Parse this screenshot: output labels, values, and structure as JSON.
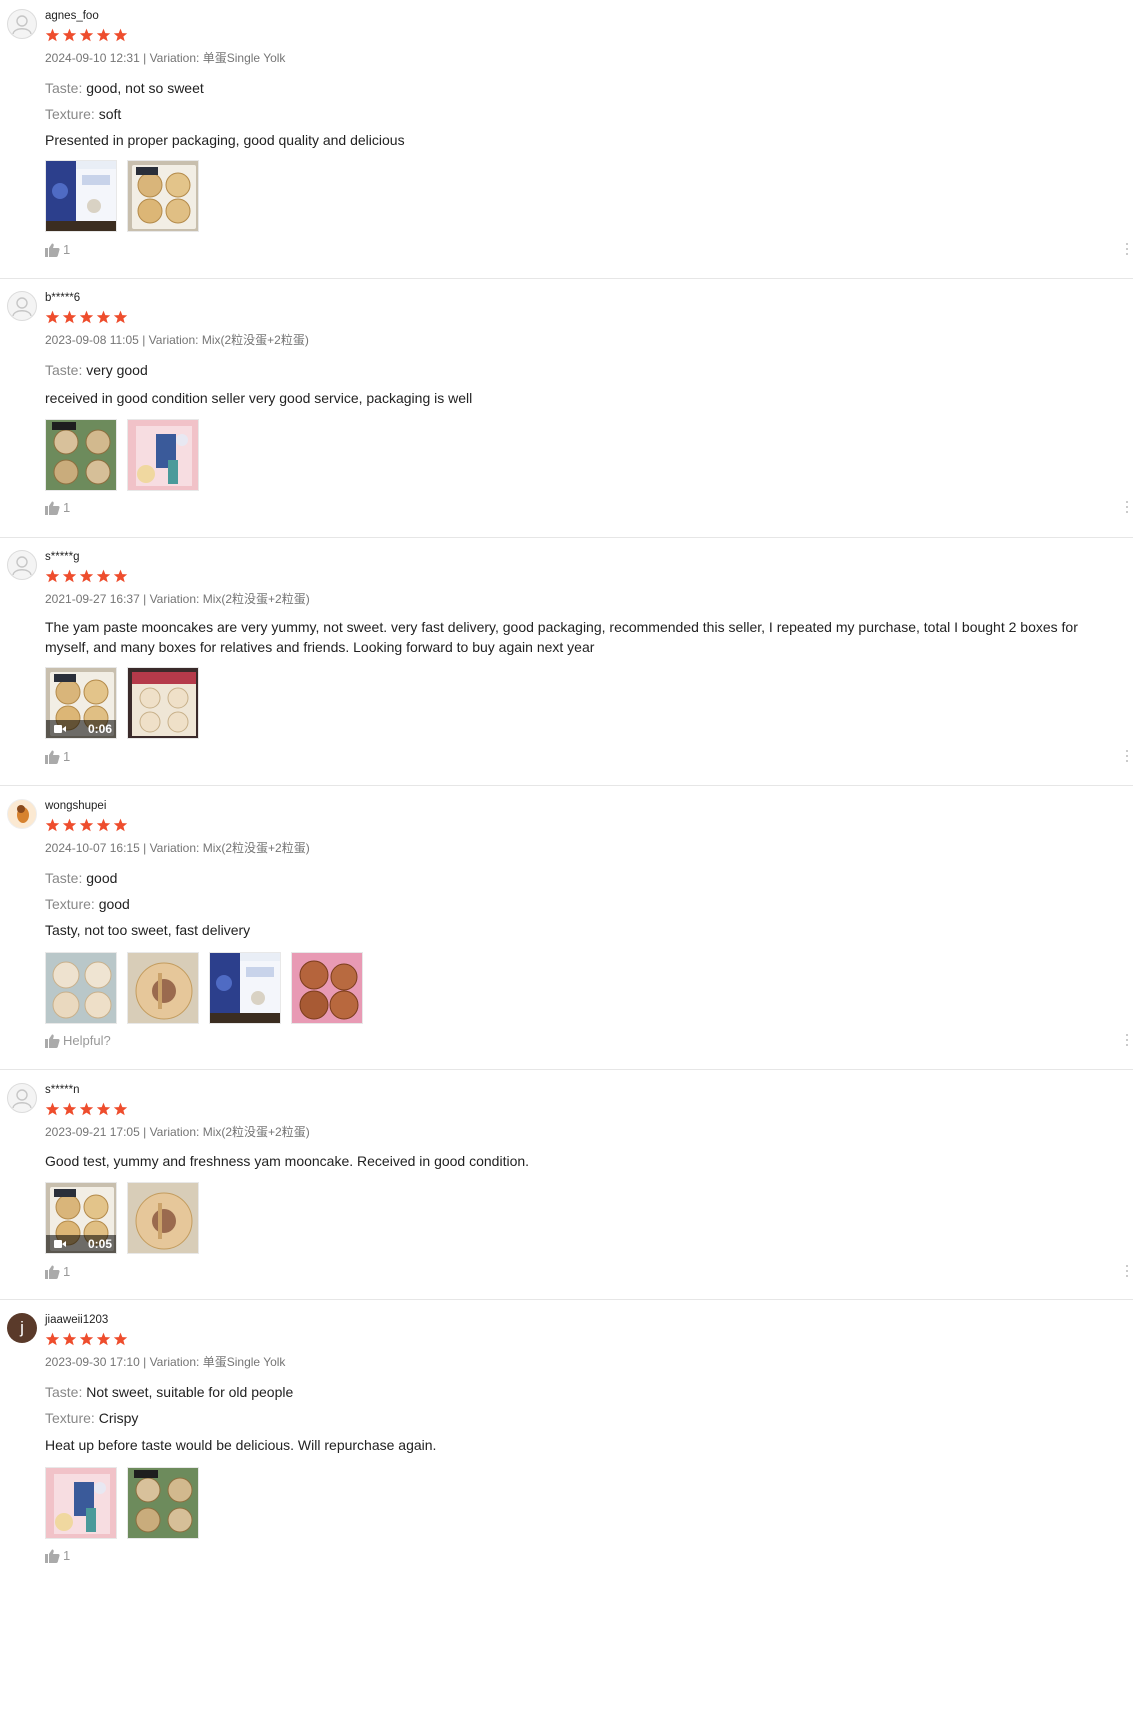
{
  "reviews": [
    {
      "username": "agnes_foo",
      "avatar": "default-avatar-icon",
      "rating": 5,
      "date": "2024-09-10 12:31",
      "variation": "单蛋Single Yolk",
      "attributes": [
        {
          "key": "Taste:",
          "value": "good, not so sweet"
        },
        {
          "key": "Texture:",
          "value": "soft"
        }
      ],
      "comment": "Presented in proper packaging, good quality and delicious",
      "media": [
        {
          "kind": "photo",
          "theme": "blue-box"
        },
        {
          "kind": "photo",
          "theme": "box-cakes"
        }
      ],
      "likes": "1"
    },
    {
      "username": "b*****6",
      "avatar": "default-avatar-icon",
      "rating": 5,
      "date": "2023-09-08 11:05",
      "variation": "Mix(2粒没蛋+2粒蛋)",
      "attributes": [
        {
          "key": "Taste:",
          "value": "very good"
        }
      ],
      "comment": "received in good condition seller very good service, packaging is well",
      "media": [
        {
          "kind": "photo",
          "theme": "green-cakes"
        },
        {
          "kind": "photo",
          "theme": "pink-box"
        }
      ],
      "likes": "1"
    },
    {
      "username": "s*****g",
      "avatar": "default-avatar-icon",
      "rating": 5,
      "date": "2021-09-27 16:37",
      "variation": "Mix(2粒没蛋+2粒蛋)",
      "attributes": [],
      "comment": "The yam paste mooncakes are very yummy, not sweet. very fast delivery, good packaging, recommended this seller, I repeated my purchase, total I bought 2 boxes for myself, and many boxes for relatives and friends. Looking forward to buy again next year",
      "media": [
        {
          "kind": "video",
          "theme": "box-cakes",
          "duration": "0:06"
        },
        {
          "kind": "photo",
          "theme": "red-box"
        }
      ],
      "likes": "1"
    },
    {
      "username": "wongshupei",
      "avatar": "photo-avatar-icon",
      "rating": 5,
      "date": "2024-10-07 16:15",
      "variation": "Mix(2粒没蛋+2粒蛋)",
      "attributes": [
        {
          "key": "Taste:",
          "value": "good"
        },
        {
          "key": "Texture:",
          "value": "good"
        }
      ],
      "comment": "Tasty, not too sweet, fast delivery",
      "media": [
        {
          "kind": "photo",
          "theme": "white-cakes"
        },
        {
          "kind": "photo",
          "theme": "cut-cake"
        },
        {
          "kind": "photo",
          "theme": "blue-box"
        },
        {
          "kind": "photo",
          "theme": "pink-cakes"
        }
      ],
      "likes": "Helpful?"
    },
    {
      "username": "s*****n",
      "avatar": "default-avatar-icon",
      "rating": 5,
      "date": "2023-09-21 17:05",
      "variation": "Mix(2粒没蛋+2粒蛋)",
      "attributes": [],
      "comment": "Good test, yummy and freshness yam mooncake. Received in good condition.",
      "media": [
        {
          "kind": "video",
          "theme": "box-cakes",
          "duration": "0:05"
        },
        {
          "kind": "photo",
          "theme": "cut-cake"
        }
      ],
      "likes": "1"
    },
    {
      "username": "jiaaweii1203",
      "avatar": "letter-avatar-icon",
      "avatar_letter": "j",
      "rating": 5,
      "date": "2023-09-30 17:10",
      "variation": "单蛋Single Yolk",
      "attributes": [
        {
          "key": "Taste:",
          "value": "Not sweet, suitable for old people"
        },
        {
          "key": "Texture:",
          "value": "Crispy"
        }
      ],
      "comment": "Heat up before taste would be delicious. Will repurchase again.",
      "media": [
        {
          "kind": "photo",
          "theme": "pink-box"
        },
        {
          "kind": "photo",
          "theme": "green-cakes"
        }
      ],
      "likes": "1"
    }
  ],
  "labels": {
    "variation_prefix": "Variation:",
    "separator": "|"
  },
  "colors": {
    "star": "#ee4d2d",
    "meta_text": "#757575",
    "attr_key": "#888888",
    "divider": "#e6e6e6"
  }
}
